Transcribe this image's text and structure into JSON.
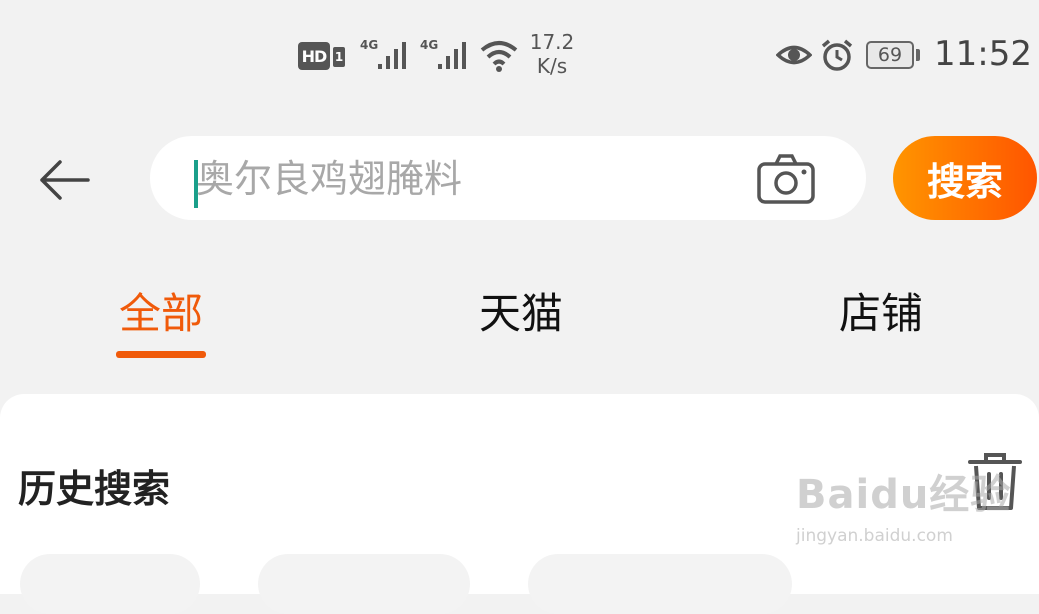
{
  "status_bar": {
    "hd_label": "HD",
    "sim_label": "1",
    "signal_label_1": "4G",
    "signal_label_2": "4G",
    "speed_value": "17.2",
    "speed_unit": "K/s",
    "battery_level": "69",
    "time": "11:52",
    "icons": [
      "eye-icon",
      "alarm-icon",
      "wifi-icon",
      "signal-icon"
    ]
  },
  "search": {
    "placeholder": "奥尔良鸡翅腌料",
    "value": "",
    "button_label": "搜索"
  },
  "tabs": [
    {
      "label": "全部",
      "active": true
    },
    {
      "label": "天猫",
      "active": false
    },
    {
      "label": "店铺",
      "active": false
    }
  ],
  "history": {
    "title": "历史搜索"
  },
  "watermark": {
    "main": "Baidu经验",
    "sub": "jingyan.baidu.com"
  },
  "colors": {
    "accent": "#f05a0a",
    "search_button_start": "#ff9500",
    "search_button_end": "#ff5500",
    "cursor": "#1a9f8a",
    "background": "#f2f2f2"
  }
}
